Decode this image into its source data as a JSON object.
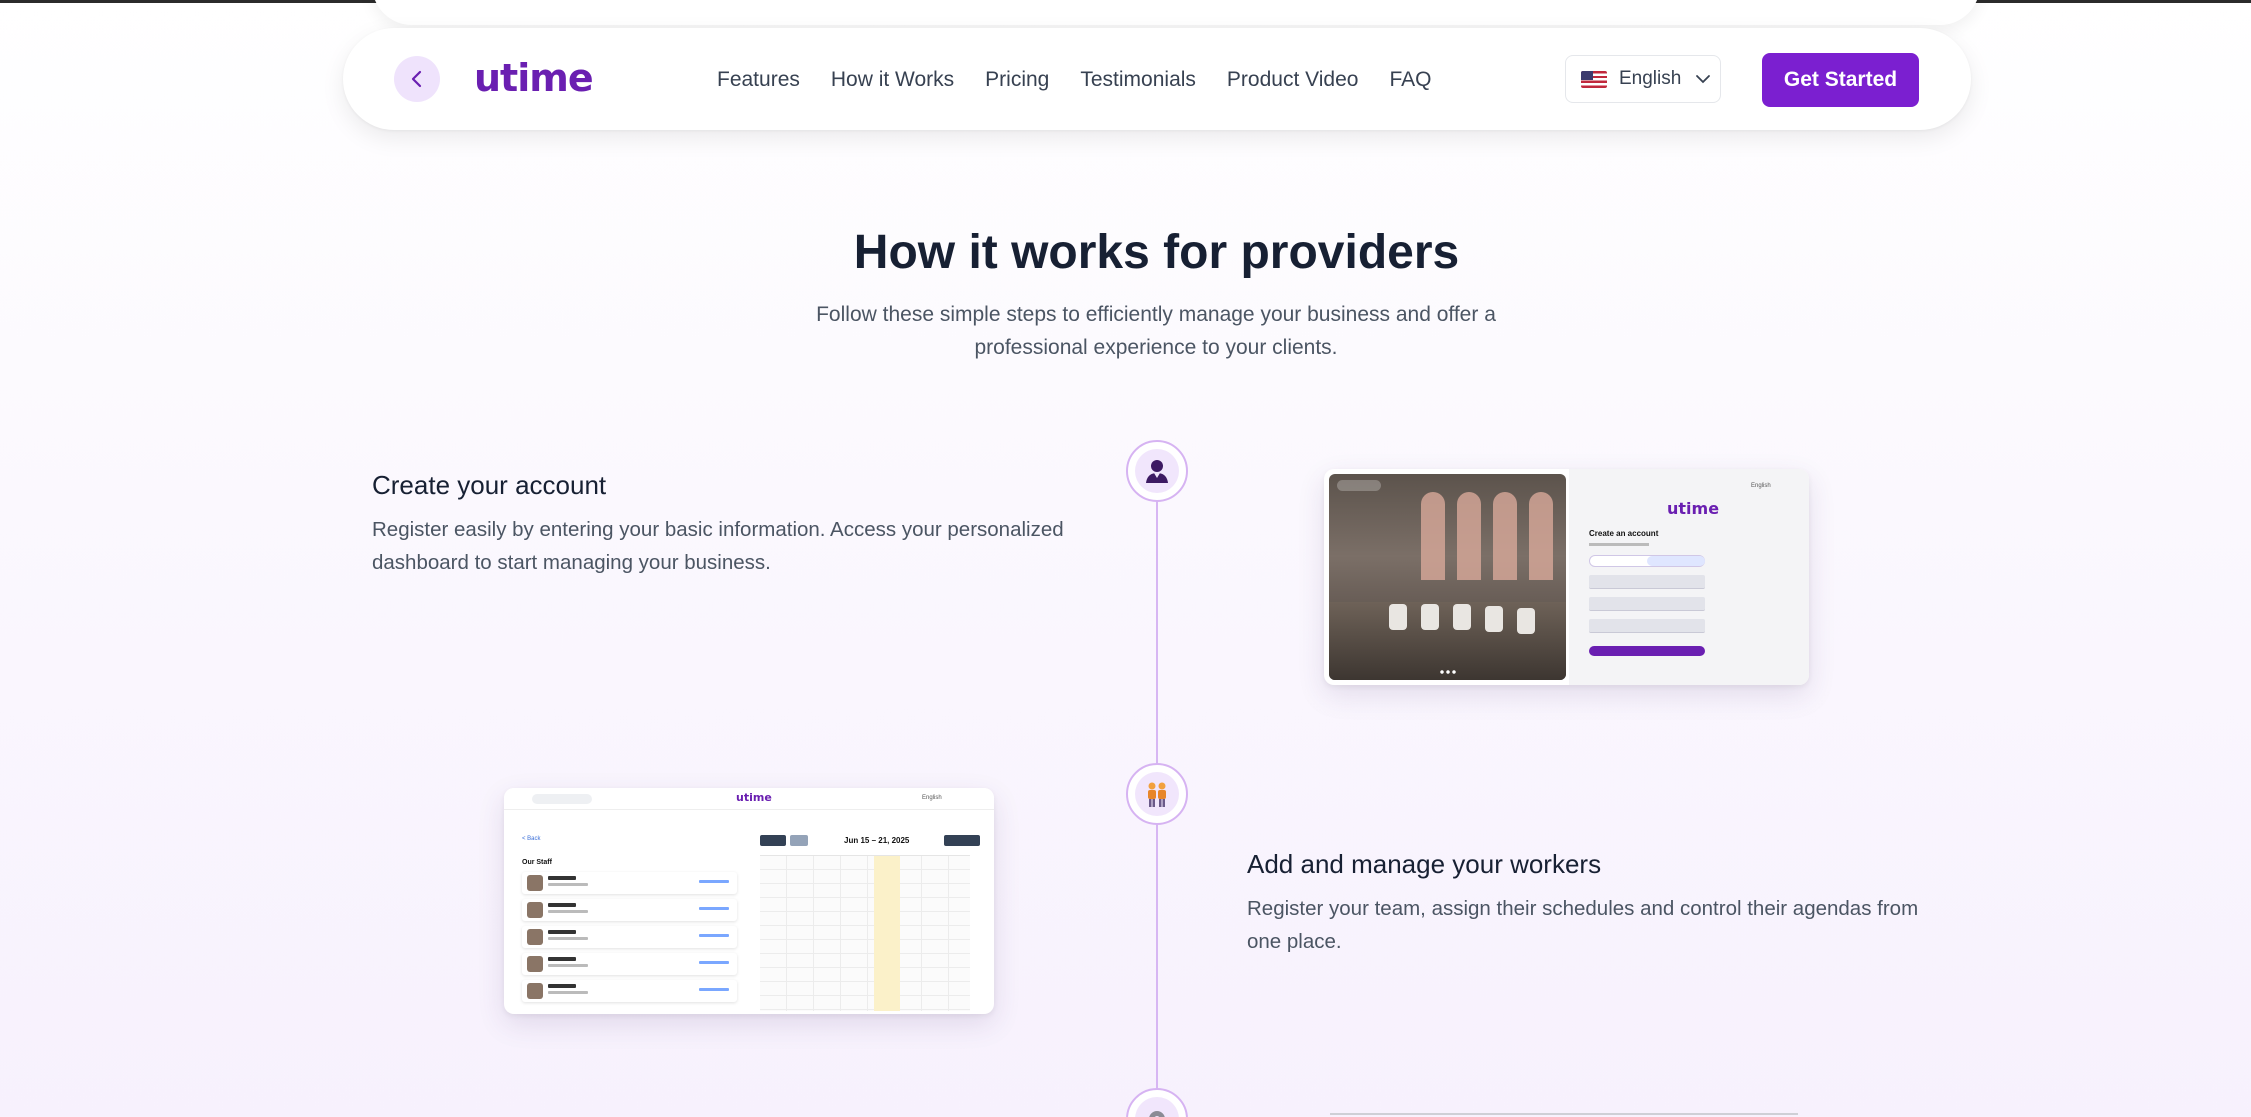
{
  "nav": {
    "back_label": "Back",
    "logo_text": "utime",
    "links": [
      "Features",
      "How it Works",
      "Pricing",
      "Testimonials",
      "Product Video",
      "FAQ"
    ],
    "language": "English",
    "cta": "Get Started"
  },
  "section": {
    "title": "How it works for providers",
    "subtitle": "Follow these simple steps to efficiently manage your business and offer a professional experience to your clients."
  },
  "steps": [
    {
      "icon": "user-icon",
      "title": "Create your account",
      "description": "Register easily by entering your basic information. Access your personalized dashboard to start managing your business.",
      "screenshot": {
        "logo": "utime",
        "heading": "Create an account",
        "language": "English"
      }
    },
    {
      "icon": "team-icon",
      "title": "Add and manage your workers",
      "description": "Register your team, assign their schedules and control their agendas from one place.",
      "screenshot": {
        "logo": "utime",
        "back_link": "< Back",
        "staff_heading": "Our Staff",
        "date_range": "Jun 15 – 21, 2025",
        "language": "English"
      }
    },
    {
      "icon": "gear-icon"
    }
  ],
  "colors": {
    "brand": "#7b1fd0",
    "timeline": "#d7b6f3",
    "node_fill": "#f1e6fc"
  }
}
